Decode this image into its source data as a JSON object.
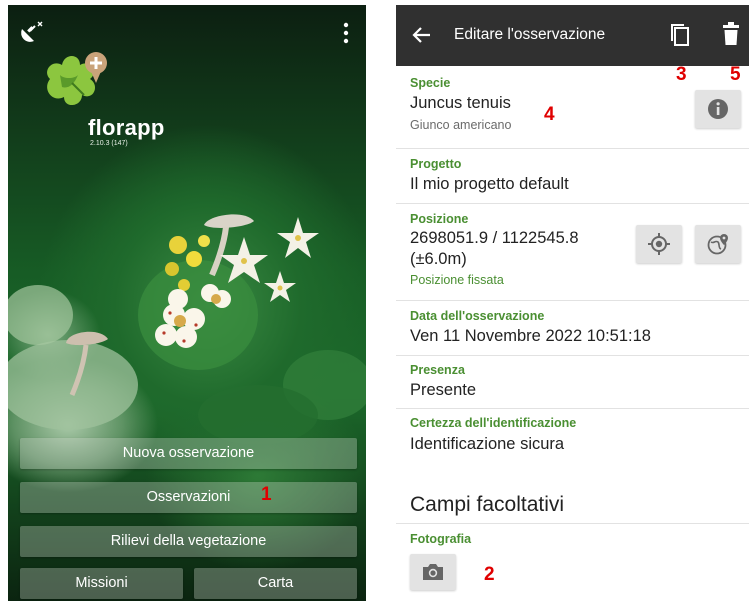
{
  "home": {
    "app_name": "florapp",
    "version": "2.10.3 (147)",
    "buttons": {
      "new_observation": "Nuova osservazione",
      "observations": "Osservazioni",
      "vegetation_surveys": "Rilievi della vegetazione",
      "missions": "Missioni",
      "map": "Carta"
    },
    "icons": [
      "satellite-off-icon",
      "more-vert-icon",
      "logo-leaf-plus-icon"
    ]
  },
  "edit": {
    "title": "Editare l'osservazione",
    "icons": [
      "arrow-back-icon",
      "copy-icon",
      "trash-icon",
      "info-icon",
      "gps-target-icon",
      "globe-pin-icon",
      "camera-icon"
    ],
    "species": {
      "label": "Specie",
      "value": "Juncus tenuis",
      "common_name": "Giunco americano"
    },
    "project": {
      "label": "Progetto",
      "value": "Il mio progetto default"
    },
    "position": {
      "label": "Posizione",
      "coords": "2698051.9 / 1122545.8",
      "accuracy": "(±6.0m)",
      "status": "Posizione fissata"
    },
    "date": {
      "label": "Data dell'osservazione",
      "value": "Ven 11 Novembre 2022 10:51:18"
    },
    "presence": {
      "label": "Presenza",
      "value": "Presente"
    },
    "certainty": {
      "label": "Certezza dell'identificazione",
      "value": "Identificazione sicura"
    },
    "optional_section": "Campi facoltativi",
    "photo": {
      "label": "Fotografia"
    }
  },
  "markers": {
    "m1": "1",
    "m2": "2",
    "m3": "3",
    "m4": "4",
    "m5": "5"
  },
  "colors": {
    "appbar": "#303030",
    "label_green": "#4a8f32",
    "marker_red": "#e00000",
    "icon_button_bg": "#e3e3e3"
  }
}
